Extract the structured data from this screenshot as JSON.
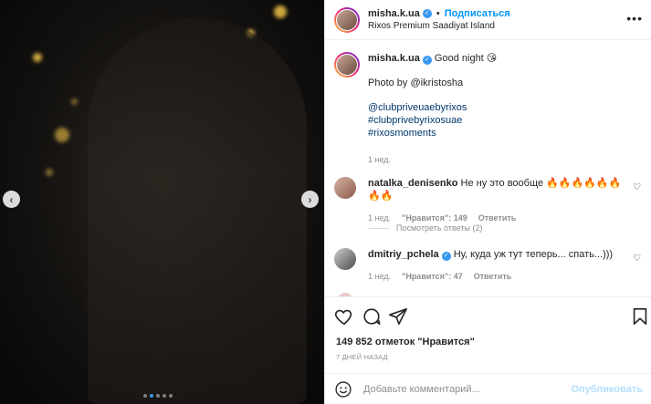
{
  "post": {
    "account": "misha.k.ua",
    "follow_label": "Подписаться",
    "separator": "•",
    "location": "Rixos Premium Saadiyat Island",
    "more_label": "•••"
  },
  "caption": {
    "username": "misha.k.ua",
    "text": "Good night 😘",
    "photo_credit": "Photo by @ikristosha",
    "hashtags": [
      "@clubpriveuaebyrixos",
      "#clubprivebyrixosuae",
      "#rixosmoments"
    ],
    "age": "1 нед."
  },
  "comments": [
    {
      "username": "natalka_denisenko",
      "text": "Не ну это вообще 🔥🔥🔥🔥🔥🔥🔥🔥",
      "age": "1 нед.",
      "likes": "\"Нравится\": 149",
      "reply_label": "Ответить",
      "view_replies": "Посмотреть ответы (2)"
    },
    {
      "username": "dmitriy_pchela",
      "text": "Ну, куда уж тут теперь... спать...)))",
      "age": "1 нед.",
      "likes": "\"Нравится\": 47",
      "reply_label": "Ответить"
    }
  ],
  "stats": {
    "likes_text": "149 852 отметок \"Нравится\"",
    "timestamp": "7 ДНЕЙ НАЗАД"
  },
  "composer": {
    "placeholder": "Добавьте комментарий...",
    "publish_label": "Опубликовать"
  },
  "carousel": {
    "prev_label": "‹",
    "next_label": "›",
    "slide_count": 5,
    "active_slide": 1
  },
  "colors": {
    "accent": "#0095f6",
    "verified": "#3897f0",
    "muted": "#8e8e8e",
    "hashtag": "#00376b",
    "publish_disabled": "#b2dffc"
  }
}
